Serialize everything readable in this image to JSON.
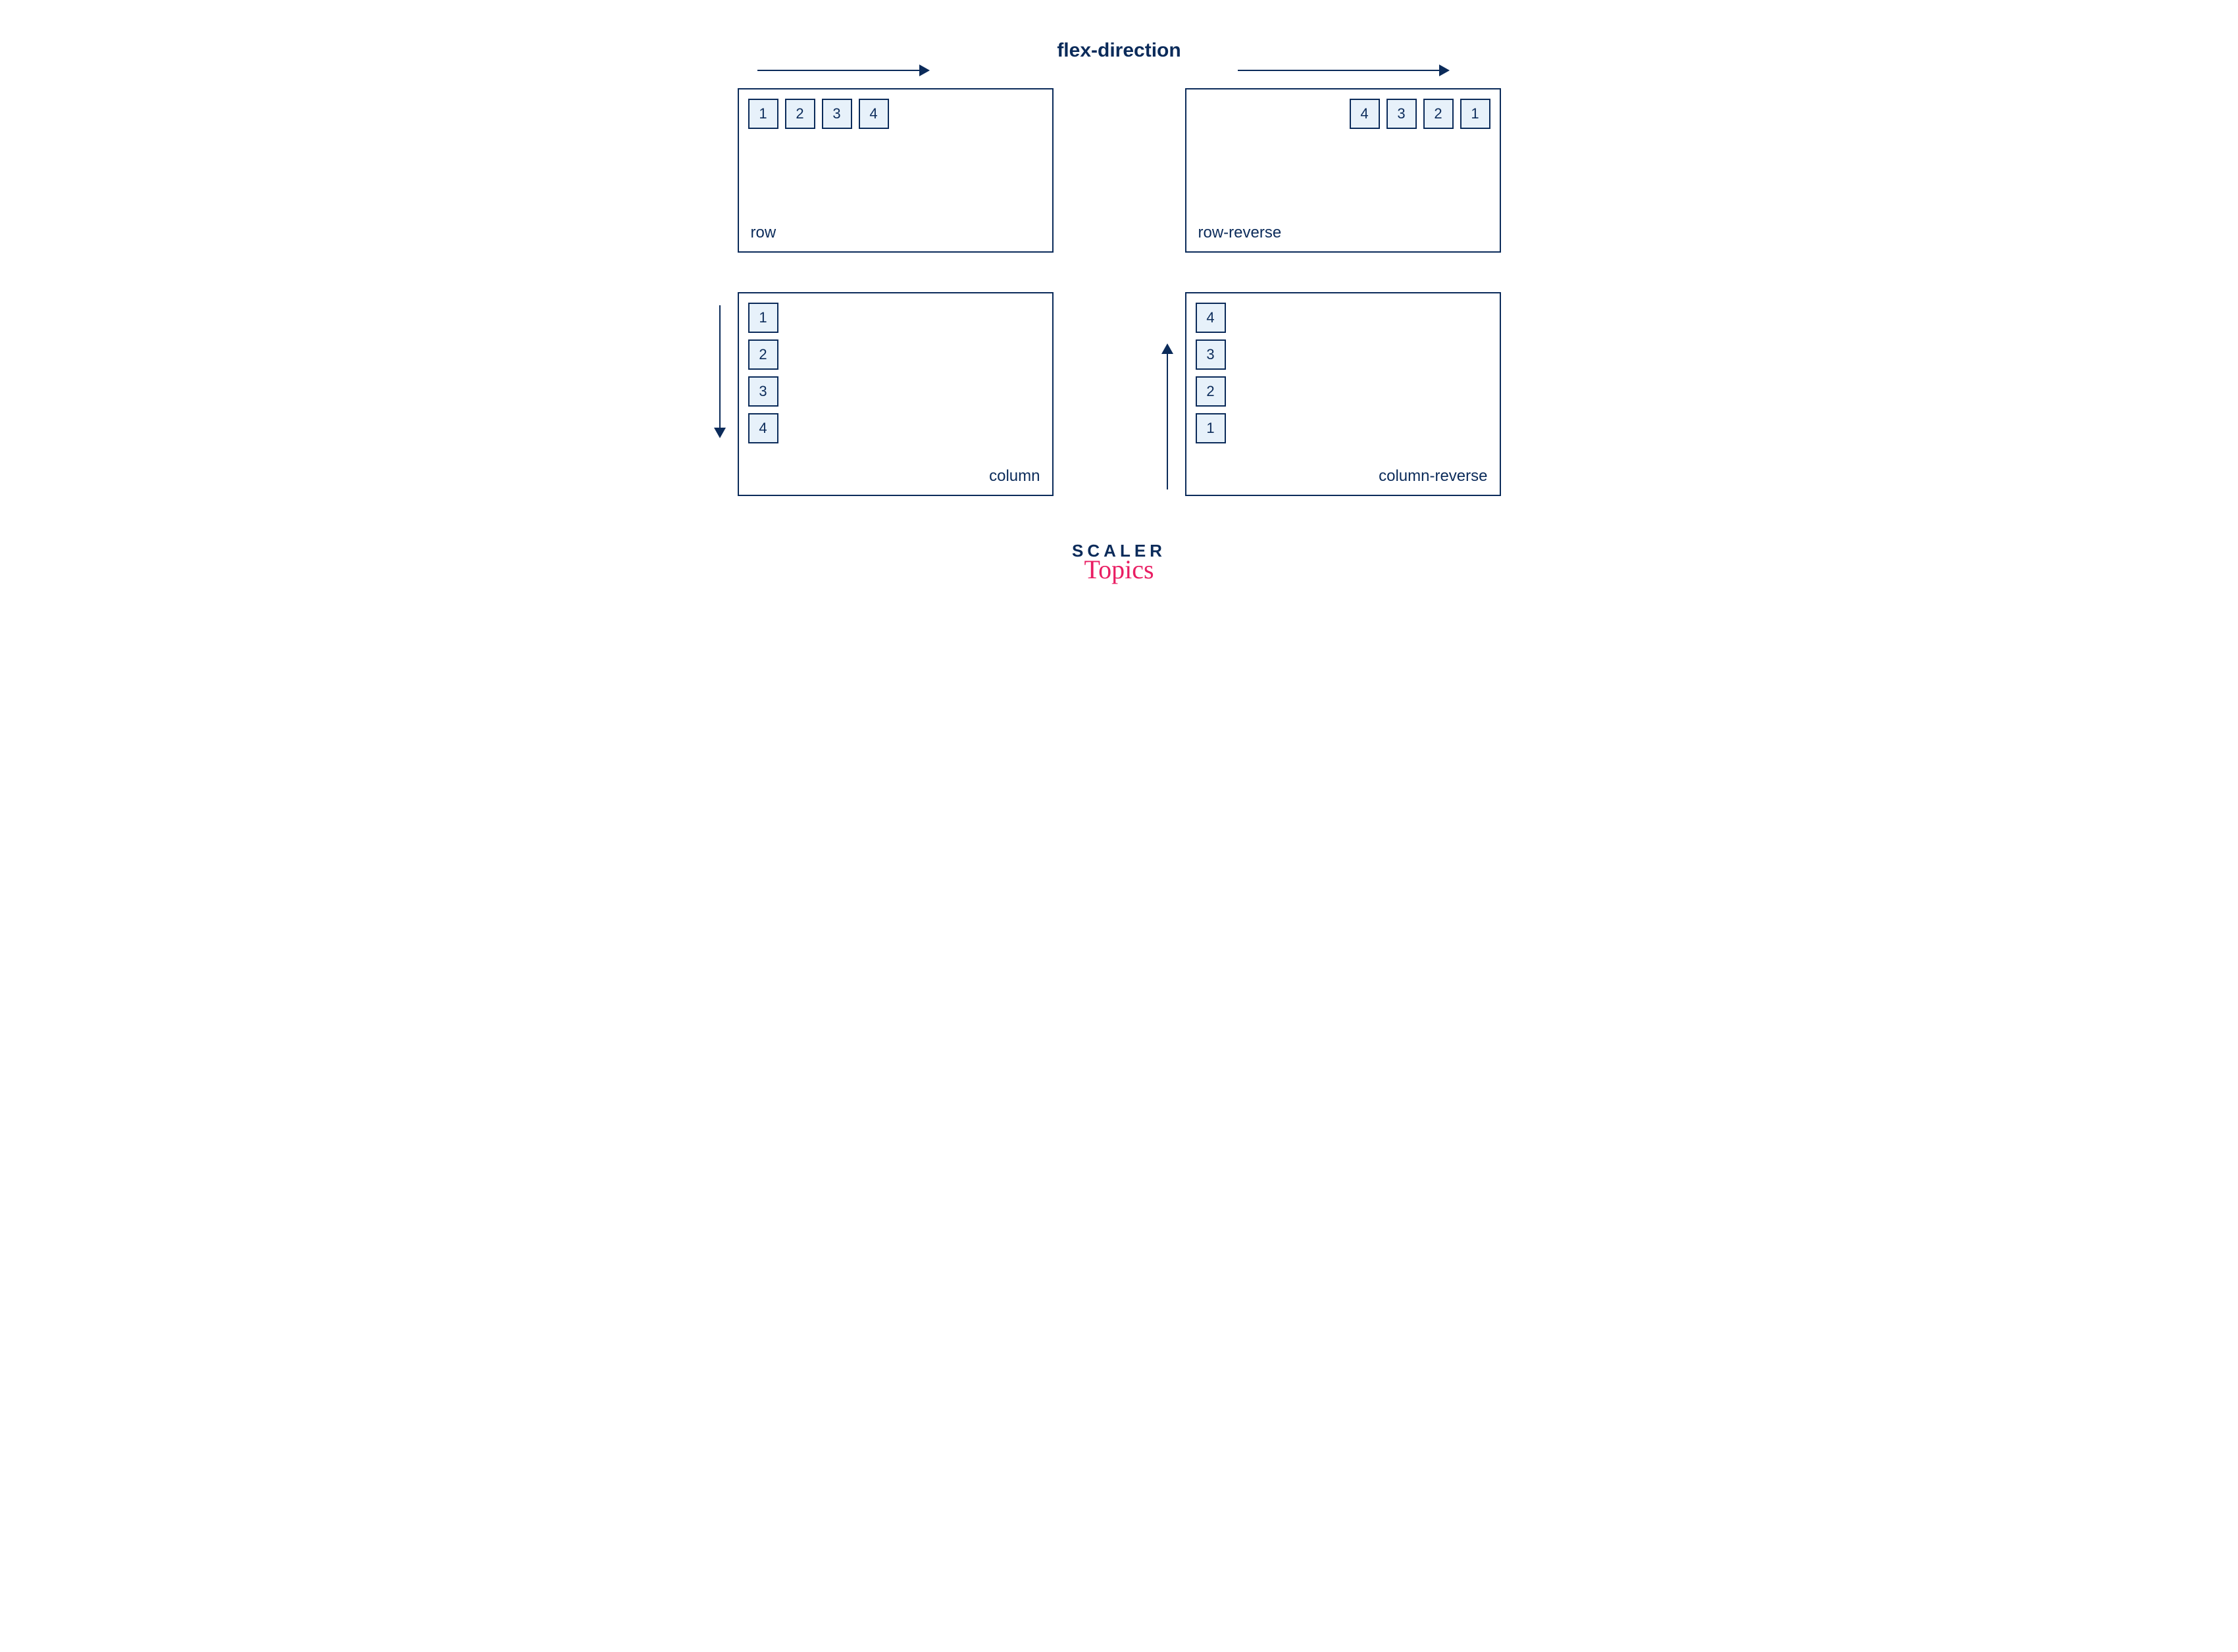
{
  "title": "flex-direction",
  "panels": {
    "row": {
      "label": "row",
      "items": [
        "1",
        "2",
        "3",
        "4"
      ]
    },
    "row_reverse": {
      "label": "row-reverse",
      "items": [
        "1",
        "2",
        "3",
        "4"
      ]
    },
    "column": {
      "label": "column",
      "items": [
        "1",
        "2",
        "3",
        "4"
      ]
    },
    "column_reverse": {
      "label": "column-reverse",
      "items": [
        "1",
        "2",
        "3",
        "4"
      ]
    }
  },
  "logo": {
    "line1": "SCALER",
    "line2": "Topics"
  }
}
